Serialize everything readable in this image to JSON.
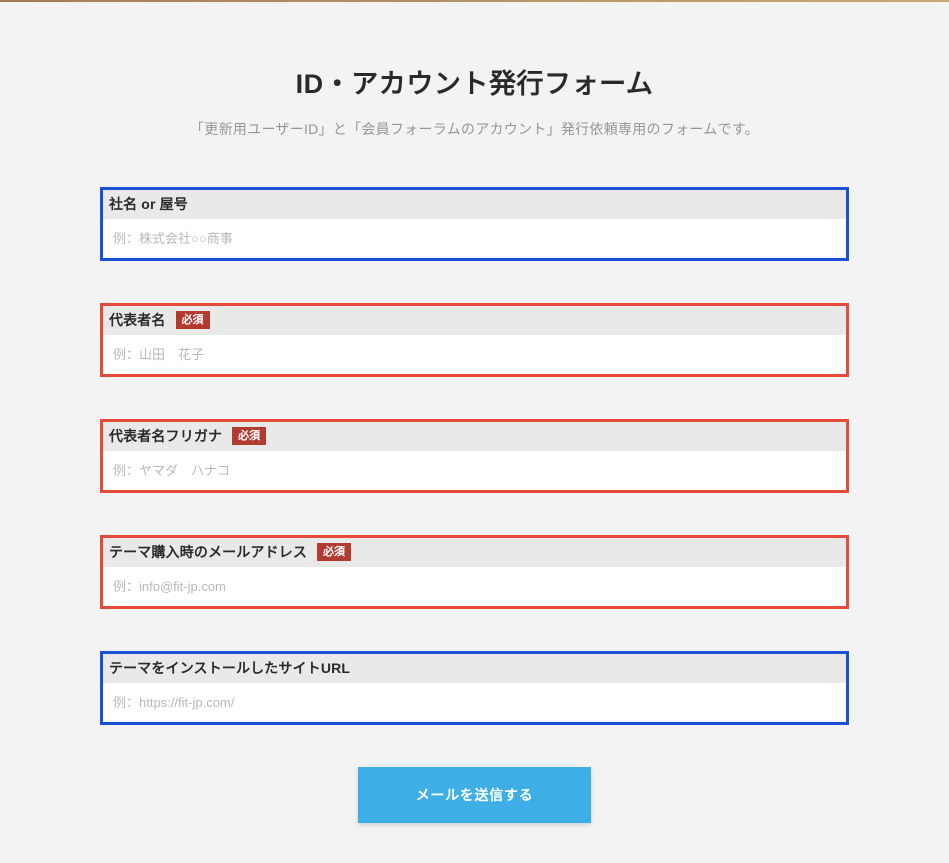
{
  "header": {
    "title": "ID・アカウント発行フォーム",
    "subtitle": "「更新用ユーザーID」と「会員フォーラムのアカウント」発行依頼専用のフォームです。"
  },
  "badges": {
    "required": "必須"
  },
  "fields": {
    "company": {
      "label": "社名 or 屋号",
      "placeholder": "例：株式会社○○商事"
    },
    "rep_name": {
      "label": "代表者名",
      "placeholder": "例：山田　花子"
    },
    "rep_kana": {
      "label": "代表者名フリガナ",
      "placeholder": "例：ヤマダ　ハナコ"
    },
    "email": {
      "label": "テーマ購入時のメールアドレス",
      "placeholder": "例：info@fit-jp.com"
    },
    "site_url": {
      "label": "テーマをインストールしたサイトURL",
      "placeholder": "例：https://fit-jp.com/"
    }
  },
  "submit": {
    "label": "メールを送信する"
  }
}
